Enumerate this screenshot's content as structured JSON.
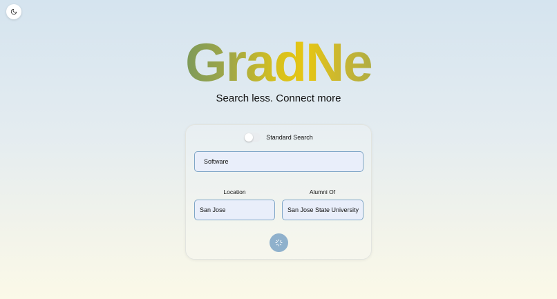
{
  "header": {
    "theme_toggle_icon": "moon-icon"
  },
  "brand": {
    "logo": "GradNet",
    "tagline": "Search less. Connect more"
  },
  "search_form": {
    "mode_toggle": {
      "label": "Standard Search",
      "enabled": false
    },
    "keyword": {
      "value": "Software"
    },
    "location": {
      "label": "Location",
      "value": "San Jose"
    },
    "alumni": {
      "label": "Alumni Of",
      "value": "San Jose State University"
    },
    "submit": {
      "icon": "loading-spinner-icon"
    }
  },
  "colors": {
    "input_border": "#7fa6c7",
    "input_bg": "#e9eefa",
    "button_bg": "#8fb1cc"
  }
}
